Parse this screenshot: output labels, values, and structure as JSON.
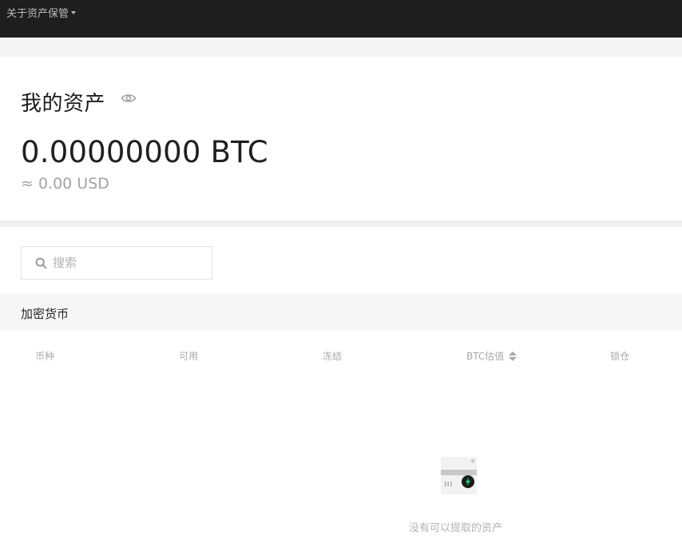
{
  "topbar": {
    "menu_label": "关于资产保管",
    "menu_icon": "caret-down-icon"
  },
  "assets": {
    "title": "我的资产",
    "visibility_icon": "eye-icon",
    "btc_balance": "0.00000000 BTC",
    "usd_estimate": "≈ 0.00 USD"
  },
  "search": {
    "icon": "search-icon",
    "placeholder": "搜索",
    "value": ""
  },
  "section": {
    "title": "加密货币"
  },
  "table": {
    "headers": [
      "币种",
      "可用",
      "冻结",
      "BTC估值",
      "锁仓"
    ],
    "sortable_column": "BTC估值",
    "rows": []
  },
  "empty_state": {
    "icon": "empty-wallet-illustration",
    "message": "没有可以提取的资产"
  },
  "colors": {
    "topbar_bg": "#1e1e20",
    "accent_green": "#19d47a",
    "muted_text": "#a9a9a9"
  }
}
